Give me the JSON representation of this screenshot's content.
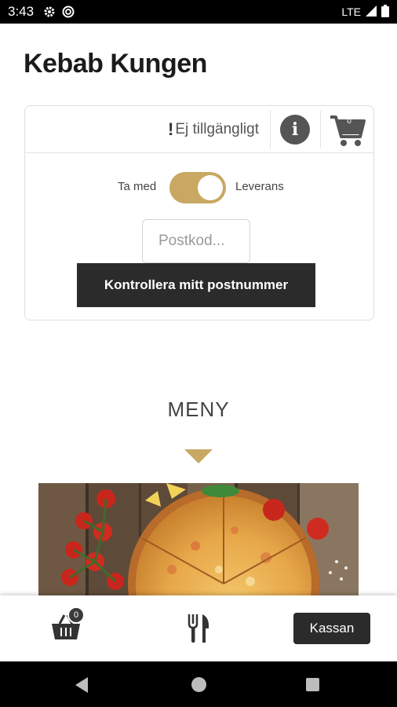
{
  "status_bar": {
    "time": "3:43",
    "network": "LTE",
    "icons": [
      "gear-icon",
      "sync-icon",
      "signal-icon",
      "battery-icon"
    ]
  },
  "app": {
    "title": "Kebab Kungen"
  },
  "order_card": {
    "availability": "Ej tillgängligt",
    "availability_mark": "!",
    "info_icon_label": "i",
    "cart_count": "0",
    "toggle": {
      "left_label": "Ta med",
      "right_label": "Leverans",
      "selected": "Leverans"
    },
    "postcode_placeholder": "Postkod...",
    "check_button": "Kontrollera mitt postnummer"
  },
  "menu": {
    "title": "MENY"
  },
  "bottom_bar": {
    "basket_count": "0",
    "checkout_button": "Kassan"
  },
  "colors": {
    "accent": "#c8a862",
    "dark_button": "#2b2b2b",
    "info_icon": "#555555"
  }
}
